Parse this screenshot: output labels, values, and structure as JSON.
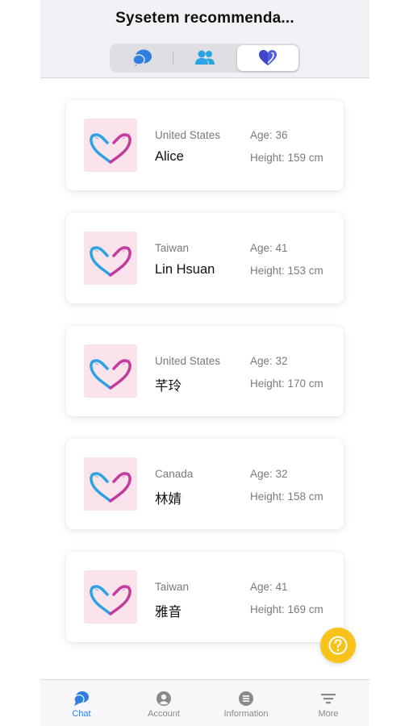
{
  "header": {
    "title": "Sysetem recommenda...",
    "segments": [
      {
        "icon": "chat-bubbles-icon"
      },
      {
        "icon": "people-icon"
      },
      {
        "icon": "heart-icon",
        "selected": true
      }
    ]
  },
  "profiles": [
    {
      "country": "United States",
      "name": "Alice",
      "age": "Age: 36",
      "height": "Height: 159 cm"
    },
    {
      "country": "Taiwan",
      "name": "Lin Hsuan",
      "age": "Age: 41",
      "height": "Height: 153 cm"
    },
    {
      "country": "United States",
      "name": "芊玲",
      "age": "Age: 32",
      "height": "Height: 170 cm"
    },
    {
      "country": "Canada",
      "name": "林婧",
      "age": "Age: 32",
      "height": "Height: 158 cm"
    },
    {
      "country": "Taiwan",
      "name": "雅音",
      "age": "Age: 41",
      "height": "Height: 169 cm"
    }
  ],
  "help_button": {
    "icon": "question-mark-icon"
  },
  "tabs": [
    {
      "label": "Chat",
      "icon": "chat-icon",
      "active": true
    },
    {
      "label": "Account",
      "icon": "account-icon"
    },
    {
      "label": "Information",
      "icon": "list-icon"
    },
    {
      "label": "More",
      "icon": "filter-icon"
    }
  ],
  "colors": {
    "accent": "#2f7ee0",
    "help": "#f7c21a",
    "avatar_bg": "#fbe3ec",
    "logo_blue": "#2aa3e3",
    "logo_magenta": "#c23a9e"
  }
}
